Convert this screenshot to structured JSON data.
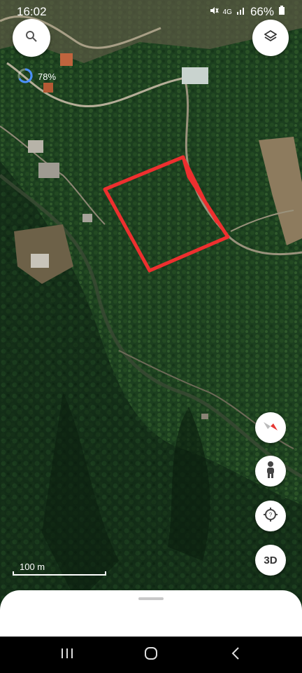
{
  "status_bar": {
    "time": "16:02",
    "network": "4G",
    "battery": "66%"
  },
  "map": {
    "loading_percent": "78%",
    "scale_label": "100 m",
    "outline_color": "#ee2f2f"
  },
  "controls": {
    "search_icon": "search-icon",
    "layers_icon": "layers-icon",
    "compass_icon": "compass-icon",
    "street_view_icon": "pegman-icon",
    "location_icon": "crosshair-icon",
    "three_d_label": "3D"
  },
  "navigation": [
    "recent-apps",
    "home",
    "back"
  ]
}
